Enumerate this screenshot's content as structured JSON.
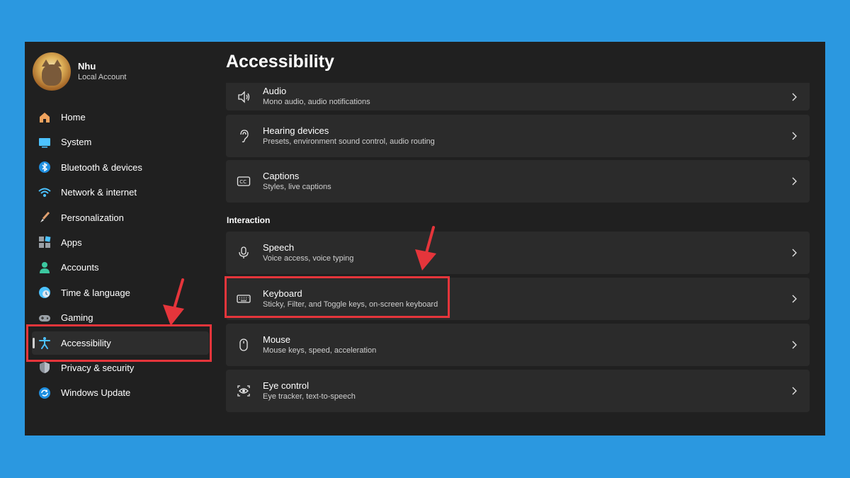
{
  "profile": {
    "name": "Nhu",
    "subtitle": "Local Account"
  },
  "nav": {
    "items": [
      {
        "label": "Home",
        "icon": "home-icon"
      },
      {
        "label": "System",
        "icon": "system-icon"
      },
      {
        "label": "Bluetooth & devices",
        "icon": "bluetooth-icon"
      },
      {
        "label": "Network & internet",
        "icon": "wifi-icon"
      },
      {
        "label": "Personalization",
        "icon": "brush-icon"
      },
      {
        "label": "Apps",
        "icon": "apps-icon"
      },
      {
        "label": "Accounts",
        "icon": "accounts-icon"
      },
      {
        "label": "Time & language",
        "icon": "time-language-icon"
      },
      {
        "label": "Gaming",
        "icon": "gaming-icon"
      },
      {
        "label": "Accessibility",
        "icon": "accessibility-icon",
        "active": true
      },
      {
        "label": "Privacy & security",
        "icon": "shield-icon"
      },
      {
        "label": "Windows Update",
        "icon": "update-icon"
      }
    ]
  },
  "main": {
    "title": "Accessibility",
    "cards_top": [
      {
        "title": "Audio",
        "subtitle": "Mono audio, audio notifications",
        "icon": "speaker-icon"
      },
      {
        "title": "Hearing devices",
        "subtitle": "Presets, environment sound control, audio routing",
        "icon": "ear-icon"
      },
      {
        "title": "Captions",
        "subtitle": "Styles, live captions",
        "icon": "captions-icon"
      }
    ],
    "section_interaction": "Interaction",
    "cards_interaction": [
      {
        "title": "Speech",
        "subtitle": "Voice access, voice typing",
        "icon": "microphone-icon"
      },
      {
        "title": "Keyboard",
        "subtitle": "Sticky, Filter, and Toggle keys, on-screen keyboard",
        "icon": "keyboard-icon"
      },
      {
        "title": "Mouse",
        "subtitle": "Mouse keys, speed, acceleration",
        "icon": "mouse-icon"
      },
      {
        "title": "Eye control",
        "subtitle": "Eye tracker, text-to-speech",
        "icon": "eye-control-icon"
      }
    ]
  },
  "colors": {
    "background": "#2b98e0",
    "window": "#202020",
    "card": "#2b2b2b",
    "annotation": "#e5353b",
    "accent": "#4cc2ff"
  }
}
